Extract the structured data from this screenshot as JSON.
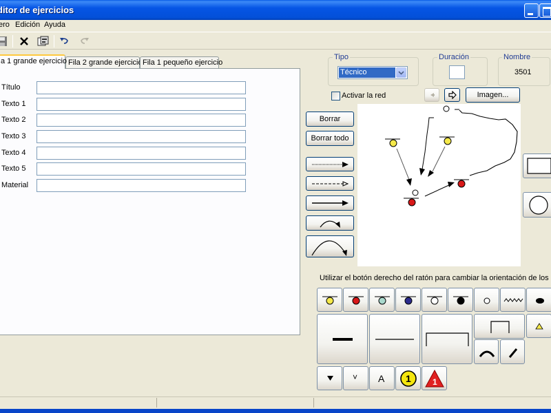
{
  "window": {
    "title": "ditor de ejercicios"
  },
  "menu": {
    "items": [
      "ero",
      "Edición",
      "Ayuda"
    ]
  },
  "toolbar": {
    "icons": [
      "save-icon",
      "delete-icon",
      "properties-icon",
      "undo-icon",
      "redo-icon"
    ]
  },
  "tabs": [
    "a 1 grande ejercicio",
    "Fila 2 grande ejercicio",
    "Fila 1 pequeño ejercicio"
  ],
  "form": {
    "fields": [
      {
        "label": "Título",
        "value": ""
      },
      {
        "label": "Texto 1",
        "value": ""
      },
      {
        "label": "Texto 2",
        "value": ""
      },
      {
        "label": "Texto 3",
        "value": ""
      },
      {
        "label": "Texto 4",
        "value": ""
      },
      {
        "label": "Texto 5",
        "value": ""
      },
      {
        "label": "Material",
        "value": ""
      }
    ]
  },
  "tipo": {
    "label": "Tipo",
    "value": "Técnico"
  },
  "duracion": {
    "label": "Duración",
    "value": ""
  },
  "nombre": {
    "label": "Nombre",
    "value": "3501"
  },
  "network": {
    "label": "Activar la red",
    "checked": false
  },
  "image_button": "Imagen...",
  "actions": {
    "clear": "Borrar",
    "clear_all": "Borrar todo"
  },
  "hint": "Utilizar el botón derecho del ratón para cambiar la orientación de los objetos",
  "symbols": {
    "text_a": "A",
    "number": "1",
    "warning": "1",
    "chevron": "˅"
  },
  "colors": {
    "yellow": "#f5e94a",
    "red": "#d81818",
    "teal": "#a9d8cc",
    "navy": "#2c2c8c",
    "accent_blue": "#316ac5"
  }
}
